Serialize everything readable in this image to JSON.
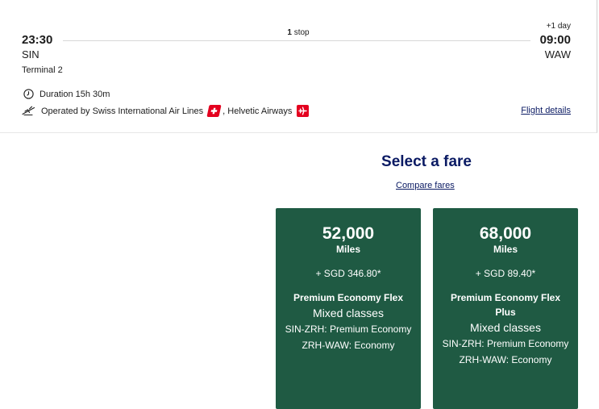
{
  "flight": {
    "departure": {
      "time": "23:30",
      "code": "SIN",
      "terminal": "Terminal 2"
    },
    "stops": {
      "count": "1",
      "label": "stop"
    },
    "arrival": {
      "day_offset": "+1 day",
      "time": "09:00",
      "code": "WAW"
    },
    "duration": "Duration 15h 30m",
    "operated_by": {
      "prefix": "Operated by Swiss International Air Lines",
      "second": ", Helvetic Airways"
    },
    "details_link": "Flight details"
  },
  "fares": {
    "title": "Select a fare",
    "compare_link": "Compare fares",
    "options": [
      {
        "miles": "52,000",
        "miles_label": "Miles",
        "price": "+ SGD 346.80*",
        "name": "Premium Economy Flex",
        "mixed": "Mixed classes",
        "segment1": "SIN-ZRH: Premium Economy",
        "segment2": "ZRH-WAW: Economy"
      },
      {
        "miles": "68,000",
        "miles_label": "Miles",
        "price": "+ SGD 89.40*",
        "name": "Premium Economy Flex Plus",
        "mixed": "Mixed classes",
        "segment1": "SIN-ZRH: Premium Economy",
        "segment2": "ZRH-WAW: Economy"
      }
    ]
  },
  "colors": {
    "navy": "#0a1a63",
    "fare_green": "#1f5a43",
    "logo_red": "#e4001f"
  },
  "icons": {
    "duration": "clock-icon",
    "operated": "plane-icon",
    "swiss": "swiss-logo-icon",
    "helvetic": "helvetic-logo-icon"
  }
}
